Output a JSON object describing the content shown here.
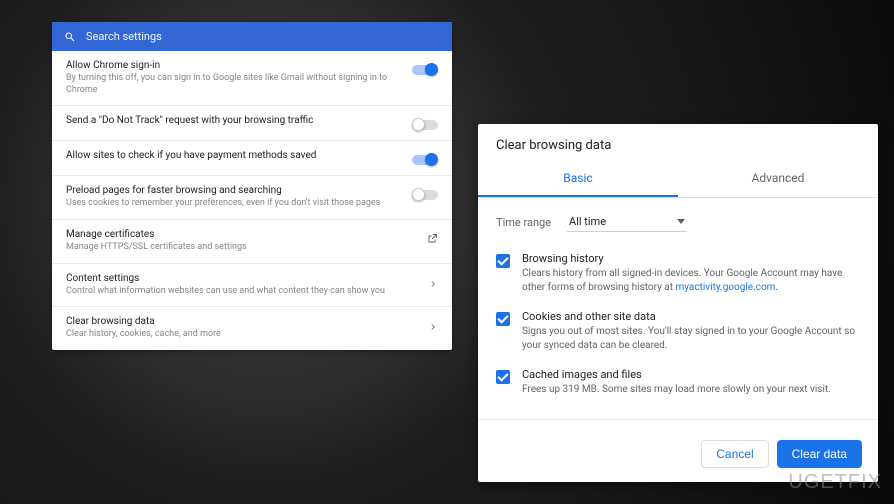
{
  "search": {
    "placeholder": "Search settings"
  },
  "settings": [
    {
      "title": "Allow Chrome sign-in",
      "desc": "By turning this off, you can sign in to Google sites like Gmail without signing in to Chrome",
      "control": "toggle",
      "on": true
    },
    {
      "title": "Send a \"Do Not Track\" request with your browsing traffic",
      "desc": "",
      "control": "toggle",
      "on": false
    },
    {
      "title": "Allow sites to check if you have payment methods saved",
      "desc": "",
      "control": "toggle",
      "on": true
    },
    {
      "title": "Preload pages for faster browsing and searching",
      "desc": "Uses cookies to remember your preferences, even if you don't visit those pages",
      "control": "toggle",
      "on": false
    },
    {
      "title": "Manage certificates",
      "desc": "Manage HTTPS/SSL certificates and settings",
      "control": "external"
    },
    {
      "title": "Content settings",
      "desc": "Control what information websites can use and what content they can show you",
      "control": "arrow"
    },
    {
      "title": "Clear browsing data",
      "desc": "Clear history, cookies, cache, and more",
      "control": "arrow"
    }
  ],
  "dialog": {
    "title": "Clear browsing data",
    "tabs": {
      "basic": "Basic",
      "advanced": "Advanced"
    },
    "time_label": "Time range",
    "time_value": "All time",
    "items": [
      {
        "title": "Browsing history",
        "desc_pre": "Clears history from all signed-in devices. Your Google Account may have other forms of browsing history at ",
        "link": "myactivity.google.com",
        "desc_post": "."
      },
      {
        "title": "Cookies and other site data",
        "desc": "Signs you out of most sites. You'll stay signed in to your Google Account so your synced data can be cleared."
      },
      {
        "title": "Cached images and files",
        "desc": "Frees up 319 MB. Some sites may load more slowly on your next visit."
      }
    ],
    "cancel": "Cancel",
    "confirm": "Clear data"
  },
  "watermark": "UGETFIX"
}
